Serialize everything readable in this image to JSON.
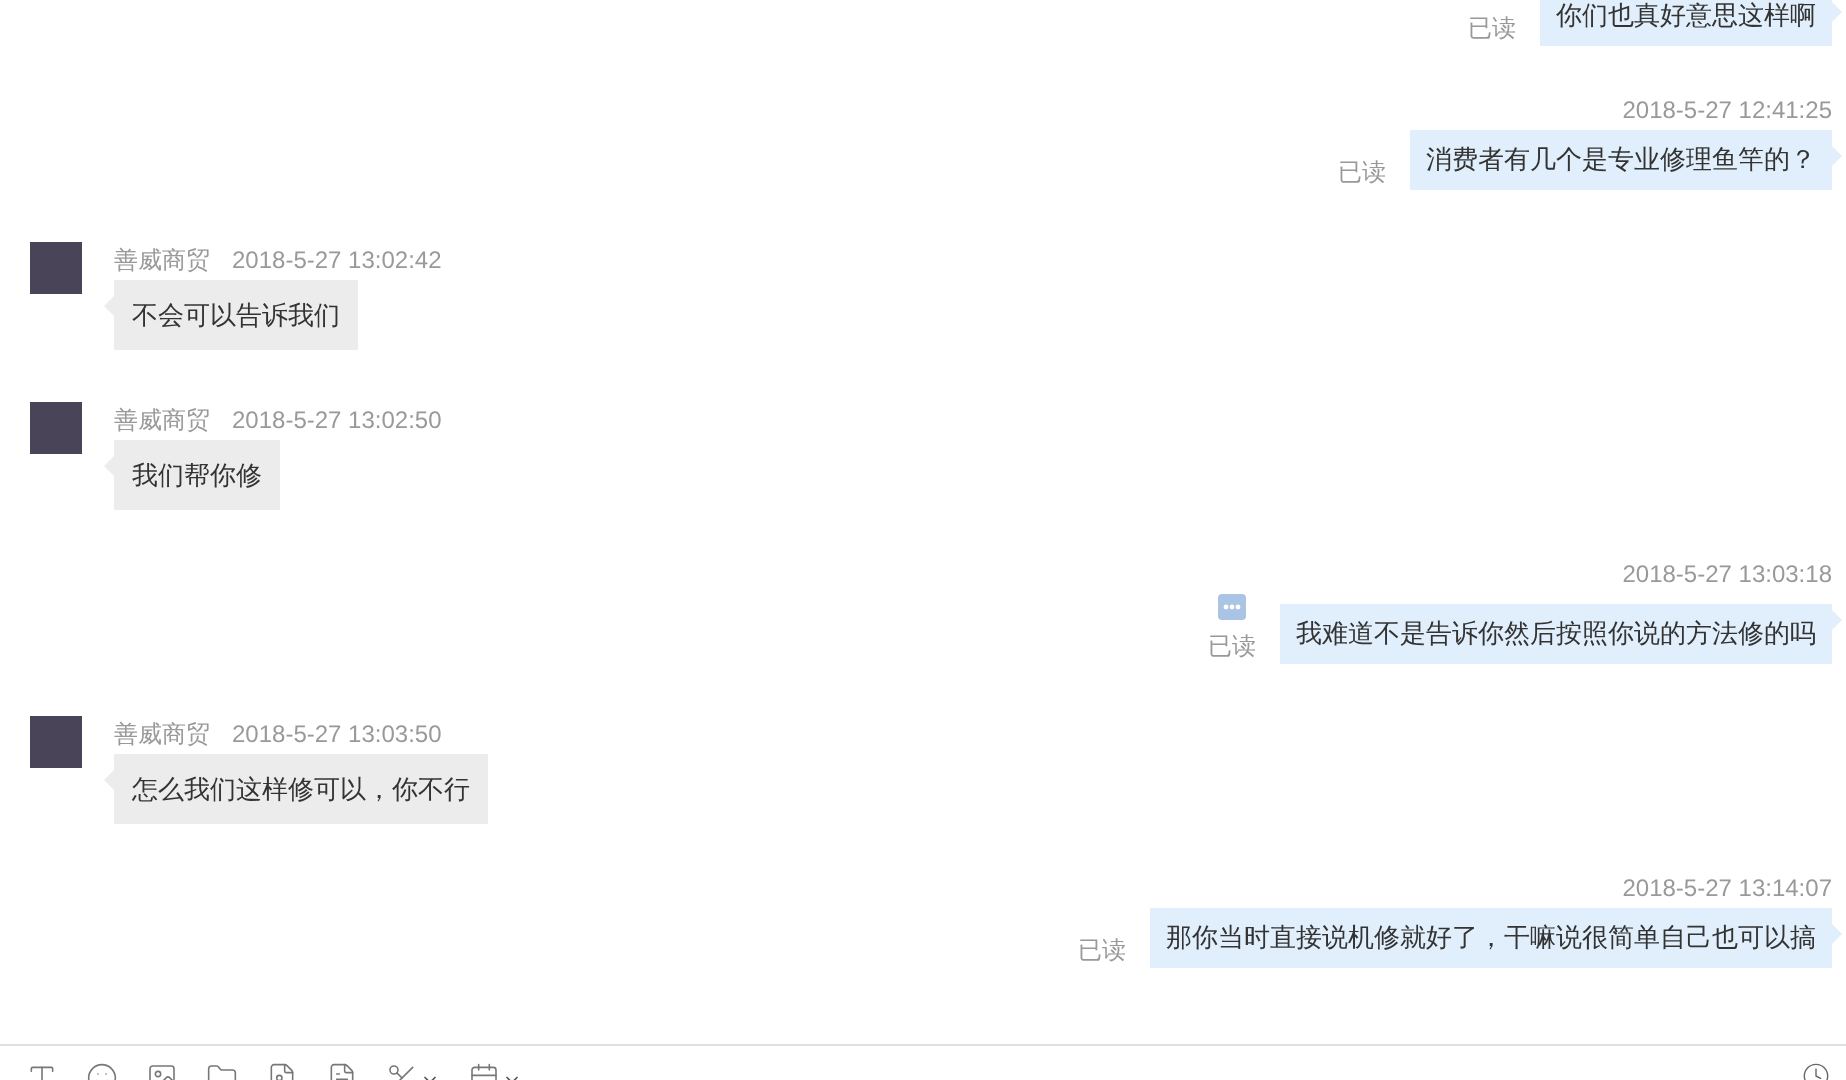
{
  "messages": [
    {
      "kind": "out",
      "text": "你们也真好意思这样啊",
      "read": "已读",
      "more_icon": false
    },
    {
      "kind": "out",
      "timestamp": "2018-5-27 12:41:25",
      "text": "消费者有几个是专业修理鱼竿的？",
      "read": "已读",
      "more_icon": false
    },
    {
      "kind": "in",
      "name": "善威商贸",
      "timestamp": "2018-5-27 13:02:42",
      "text": "不会可以告诉我们"
    },
    {
      "kind": "in",
      "name": "善威商贸",
      "timestamp": "2018-5-27 13:02:50",
      "text": "我们帮你修"
    },
    {
      "kind": "out",
      "timestamp": "2018-5-27 13:03:18",
      "text": "我难道不是告诉你然后按照你说的方法修的吗",
      "read": "已读",
      "more_icon": true
    },
    {
      "kind": "in",
      "name": "善威商贸",
      "timestamp": "2018-5-27 13:03:50",
      "text": "怎么我们这样修可以，你不行"
    },
    {
      "kind": "out",
      "timestamp": "2018-5-27 13:14:07",
      "text": "那你当时直接说机修就好了，干嘛说很简单自己也可以搞",
      "read": "已读",
      "more_icon": false
    }
  ]
}
